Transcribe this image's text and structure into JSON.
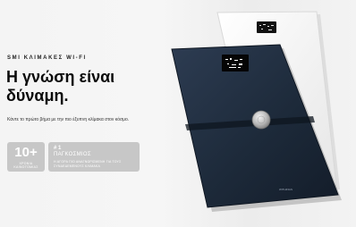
{
  "hero": {
    "eyebrow": "SMI ΚΛΙΜΑΚΕΣ WI-FI",
    "headline": "Η γνώση είναι δύναμη.",
    "subtext": "Κάντε το πρώτο βήμα με την πιο έξυπνη κλίμακα στον κόσμο."
  },
  "stats": [
    {
      "value": "10+",
      "label": "ΧΡΟΝΙΑ ΚΑΙΝΟΤΟΜΙΑΣ"
    },
    {
      "value": "# 1",
      "subtitle": "ΠΑΓΚΟΣΜΙΟΣ",
      "label": "Η ΑΓΟΡΑ ΠΙΟ ΑΝΑΓΝΩΡΙΣΜΕΝΗ ΓΙΑ ΤΟΥΣ ΣΥΝΔΕΔΕΜΕΝΟΥΣ ΚΛΙΜΑΚΑ"
    }
  ],
  "products": {
    "dark_scale": {
      "color": "#1d2a3a",
      "accent": "#2c3a4e",
      "display": "#050505",
      "brand": "WITHINGS"
    },
    "white_scale": {
      "color": "#f9f9f9",
      "display": "#111111"
    }
  }
}
